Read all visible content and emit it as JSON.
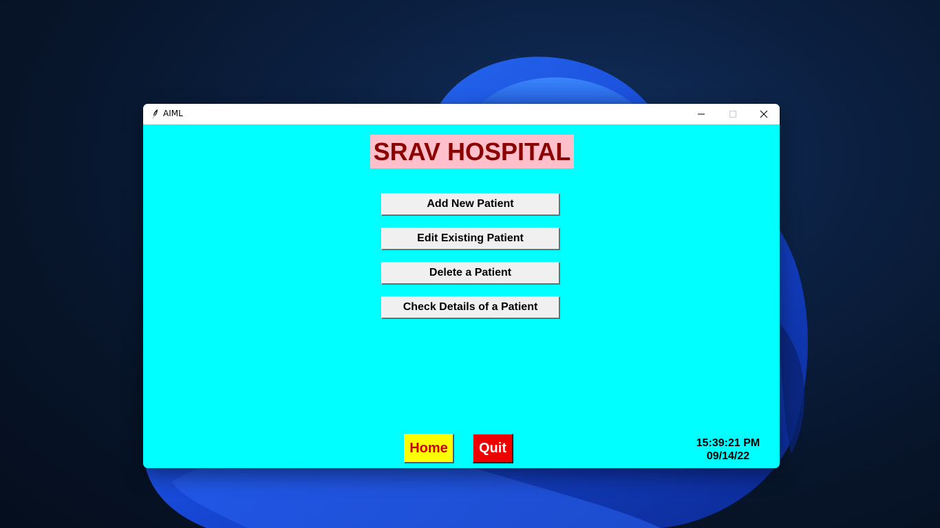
{
  "window": {
    "title": "AIML"
  },
  "heading": {
    "text": "SRAV HOSPITAL"
  },
  "menu": {
    "add_label": "Add New Patient",
    "edit_label": "Edit Existing Patient",
    "delete_label": "Delete a Patient",
    "check_label": "Check Details of a Patient"
  },
  "footer": {
    "home_label": "Home",
    "quit_label": "Quit",
    "time": "15:39:21 PM",
    "date": "09/14/22"
  },
  "colors": {
    "background": "#00ffff",
    "heading_bg": "#ffc0cb",
    "heading_fg": "#8b0000",
    "home_bg": "#ffff00",
    "home_fg": "#cc0000",
    "quit_bg": "#ee0000",
    "quit_fg": "#ffffff"
  },
  "icons": {
    "app": "feather-icon",
    "minimize": "minimize-icon",
    "maximize": "maximize-icon",
    "close": "close-icon"
  }
}
